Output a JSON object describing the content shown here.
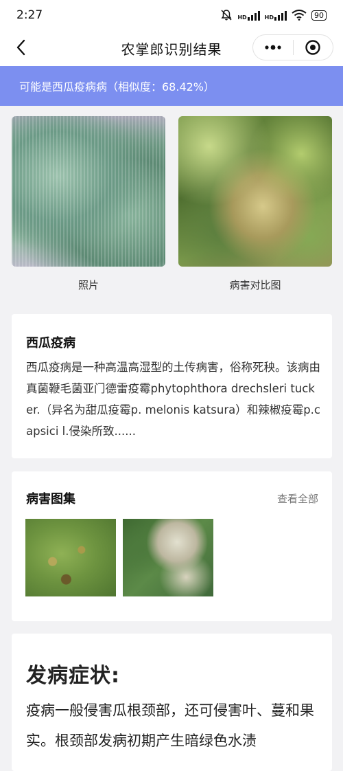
{
  "status_bar": {
    "time": "2:27",
    "hd_label": "HD",
    "battery": "90"
  },
  "navbar": {
    "title": "农掌郎识别结果"
  },
  "banner": {
    "text": "可能是西瓜疫病病（相似度：68.42%）"
  },
  "photos": [
    {
      "caption": "照片"
    },
    {
      "caption": "病害对比图"
    }
  ],
  "disease": {
    "title": "西瓜疫病",
    "description": "西瓜疫病是一种高温高湿型的土传病害，俗称死秧。该病由真菌鞭毛菌亚门德雷疫霉phytophthora drechsleri tucker.（异名为甜瓜疫霉p. melonis katsura）和辣椒疫霉p.capsici l.侵染所致......"
  },
  "gallery": {
    "title": "病害图集",
    "view_all": "查看全部"
  },
  "symptoms": {
    "title": "发病症状:",
    "text": "疫病一般侵害瓜根颈部，还可侵害叶、蔓和果实。根颈部发病初期产生暗绿色水渍"
  }
}
